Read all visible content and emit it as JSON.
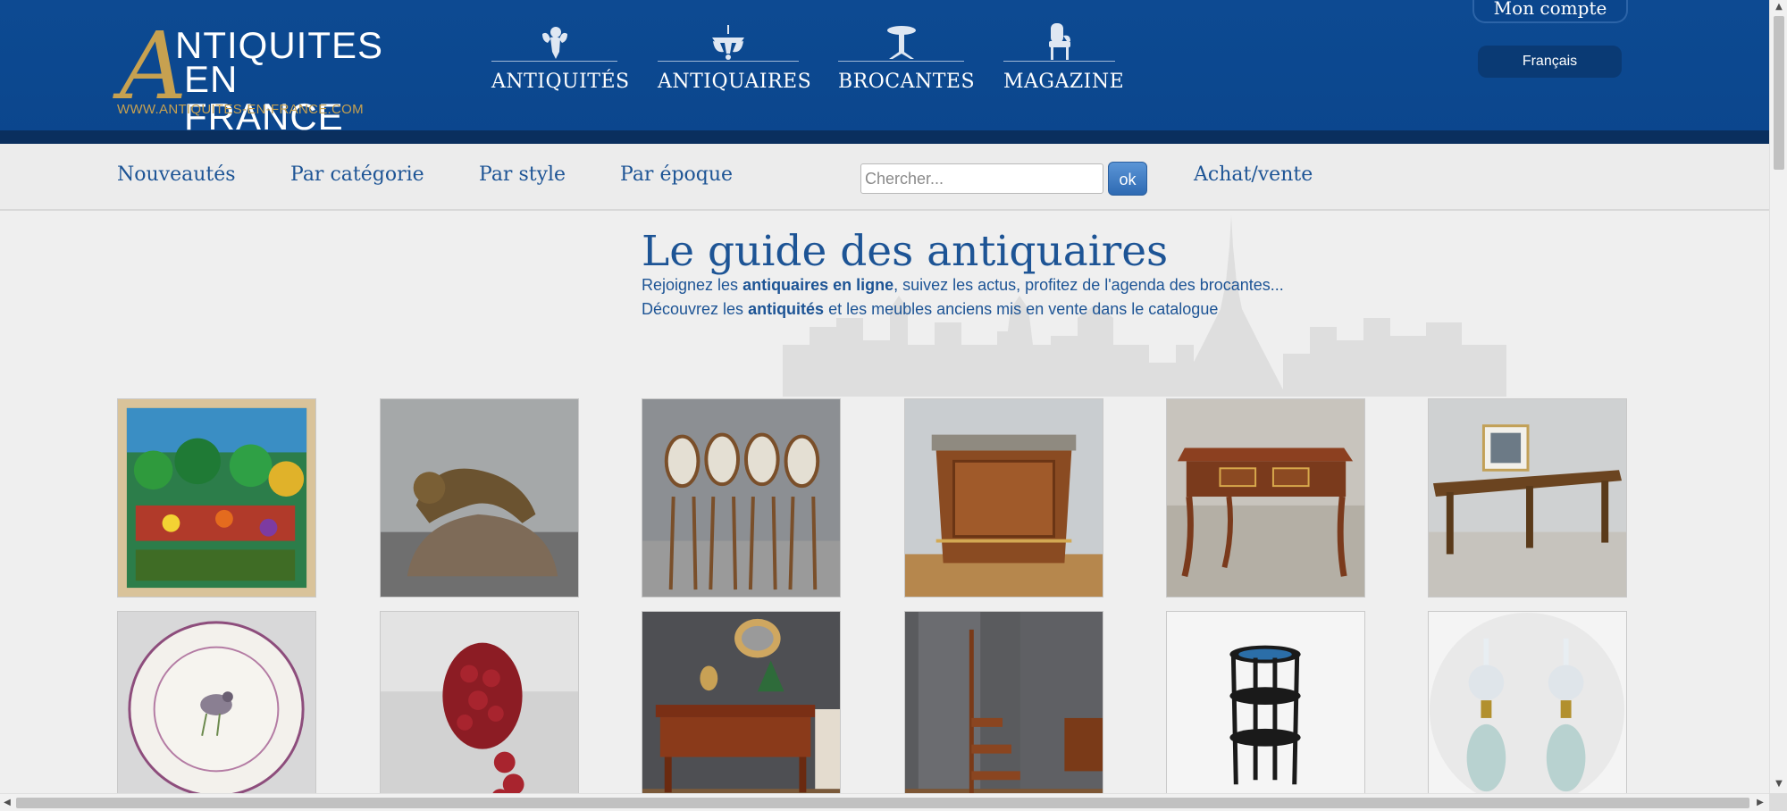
{
  "header": {
    "logo": {
      "letter": "A",
      "line1": "NTIQUITES",
      "line2": "EN FRANCE",
      "url": "WWW.ANTIQUITES-EN-FRANCE.COM",
      "accent_color": "#c7a150"
    },
    "main_nav": [
      {
        "label": "ANTIQUITÉS",
        "icon": "cherub-icon"
      },
      {
        "label": "ANTIQUAIRES",
        "icon": "chandelier-icon"
      },
      {
        "label": "BROCANTES",
        "icon": "pedestal-table-icon"
      },
      {
        "label": "MAGAZINE",
        "icon": "armchair-icon"
      }
    ],
    "account_label": "Mon compte",
    "language_label": "Français",
    "background_color": "#0b468d"
  },
  "subnav": {
    "links": [
      "Nouveautés",
      "Par catégorie",
      "Par style",
      "Par époque"
    ],
    "search_placeholder": "Chercher...",
    "search_button": "ok",
    "extra_link": "Achat/vente"
  },
  "intro": {
    "headline": "Le guide des antiquaires",
    "line1": {
      "before": "Rejoignez les ",
      "bold": "antiquaires en ligne",
      "after": ", suivez les actus, profitez de l'agenda des brocantes..."
    },
    "line2": {
      "before": "Découvrez les ",
      "bold": "antiquités",
      "after": " et les meubles anciens mis en vente dans le catalogue"
    }
  },
  "catalogue": [
    {
      "subject": "naive-painting-image"
    },
    {
      "subject": "bronze-panther-sculpture-image"
    },
    {
      "subject": "bistro-chairs-set-image"
    },
    {
      "subject": "demi-lune-commode-image"
    },
    {
      "subject": "louis-xv-desk-image"
    },
    {
      "subject": "farmhouse-table-image"
    },
    {
      "subject": "bird-plate-image"
    },
    {
      "subject": "garnet-bracelet-image"
    },
    {
      "subject": "writing-desk-image"
    },
    {
      "subject": "library-steps-image"
    },
    {
      "subject": "black-etagere-image"
    },
    {
      "subject": "opaline-oil-lamps-image"
    }
  ]
}
